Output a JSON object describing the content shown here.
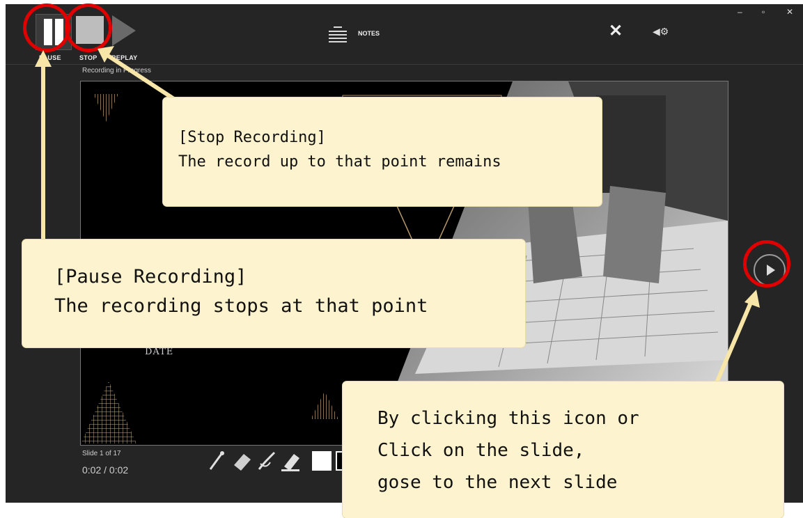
{
  "toolbar": {
    "pause_label": "PAUSE",
    "stop_label": "STOP",
    "replay_label": "REPLAY",
    "notes_label": "NOTES"
  },
  "recording_status": "Recording in Progress",
  "slide_counter": "Slide 1 of 17",
  "timer": "0:02 / 0:02",
  "slide": {
    "date_text": "DATE"
  },
  "callouts": {
    "stop": {
      "title": "[Stop Recording]",
      "body": "The record up to that point remains"
    },
    "pause": {
      "title": "[Pause Recording]",
      "body": "The recording stops at that point"
    },
    "next": {
      "line1": "By clicking this icon or",
      "line2": "Click on the slide,",
      "line3": "gose to the next slide"
    }
  },
  "colors": {
    "app_background": "#252525",
    "callout_fill": "#fdf3ce",
    "highlight_ring": "#e00000",
    "arrow": "#f8e6a8",
    "slide_accent": "#b89a6a"
  },
  "icons": [
    "pause-icon",
    "stop-icon",
    "replay-icon",
    "notes-icon",
    "close-icon",
    "speaker-settings-icon",
    "next-slide-icon",
    "laser-pointer-icon",
    "eraser-icon",
    "pen-icon",
    "highlighter-icon"
  ]
}
